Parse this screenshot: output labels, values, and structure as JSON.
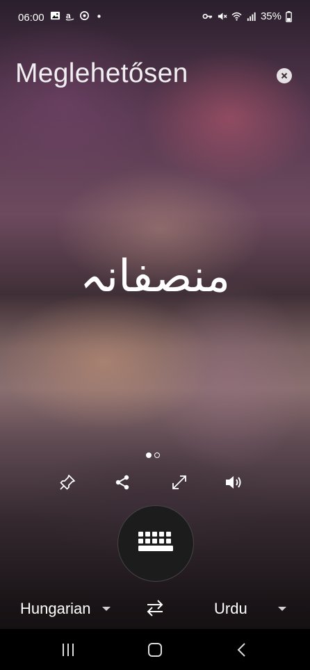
{
  "status_bar": {
    "time": "06:00",
    "battery": "35%"
  },
  "translation": {
    "source_text": "Meglehetősen",
    "translated_text": "منصفانہ",
    "pager_active_index": 0,
    "pager_count": 2
  },
  "languages": {
    "source": "Hungarian",
    "target": "Urdu"
  },
  "icons": {
    "close": "close-icon",
    "pin": "pin-icon",
    "share": "share-icon",
    "fullscreen": "expand-icon",
    "speak": "speaker-icon",
    "keyboard": "keyboard-icon",
    "swap": "swap-icon"
  }
}
